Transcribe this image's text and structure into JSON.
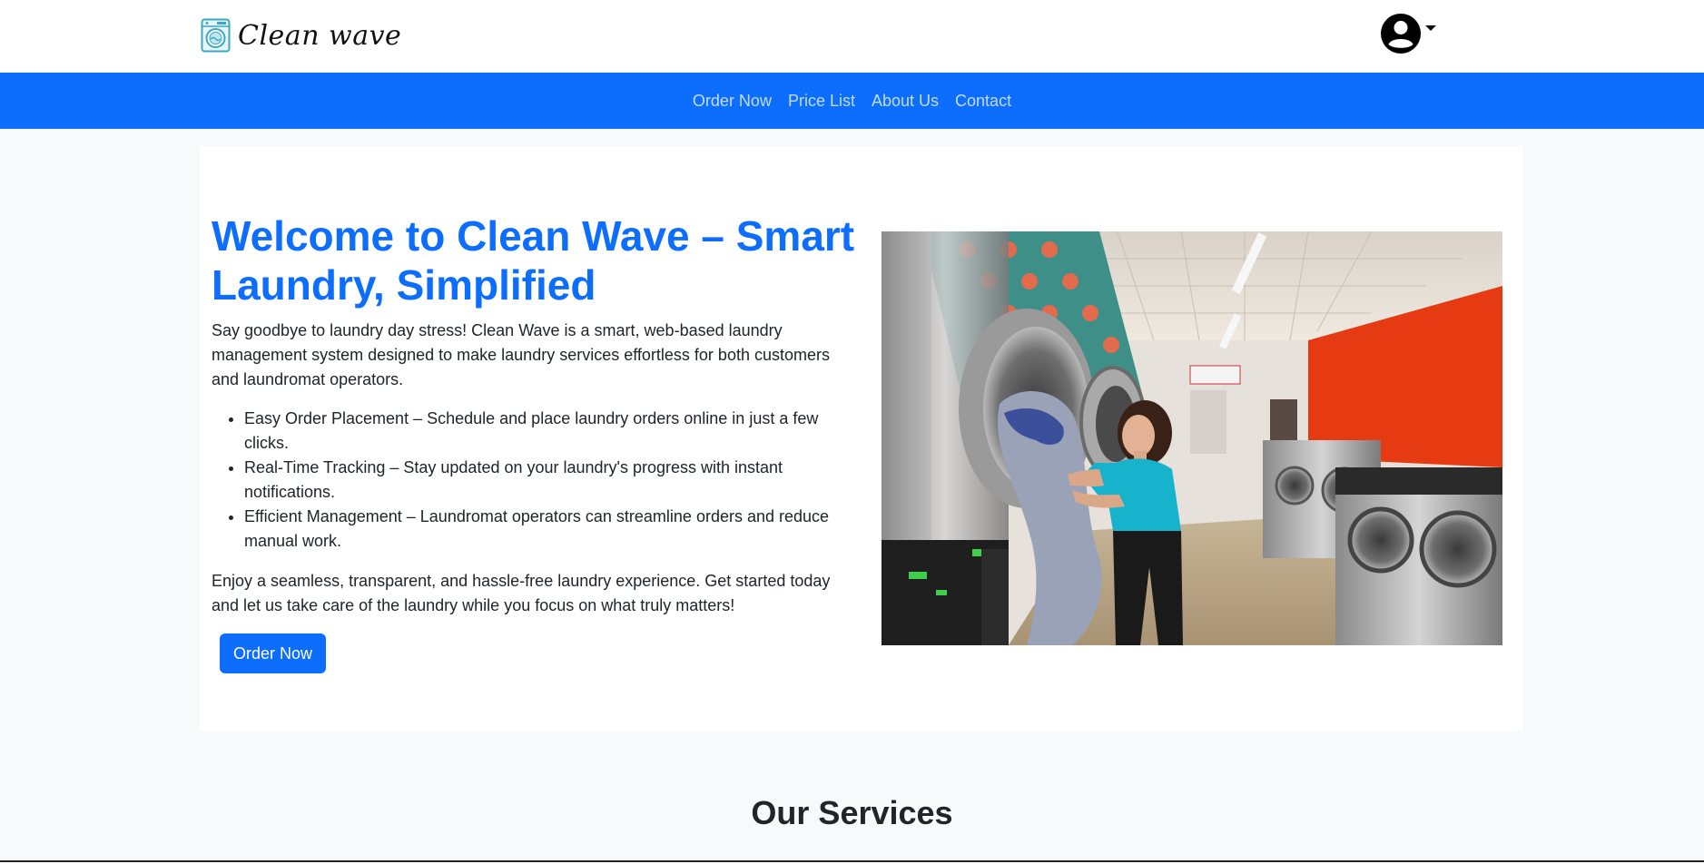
{
  "brand": {
    "name": "Clean wave",
    "logo_icon": "washing-machine-logo-icon"
  },
  "user_menu": {
    "icon": "user-circle-icon"
  },
  "nav": {
    "items": [
      {
        "label": "Order Now"
      },
      {
        "label": "Price List"
      },
      {
        "label": "About Us"
      },
      {
        "label": "Contact"
      }
    ]
  },
  "hero": {
    "title": "Welcome to Clean Wave – Smart Laundry, Simplified",
    "intro": "Say goodbye to laundry day stress! Clean Wave is a smart, web-based laundry management system designed to make laundry services effortless for both customers and laundromat operators.",
    "features": [
      "Easy Order Placement – Schedule and place laundry orders online in just a few clicks.",
      "Real-Time Tracking – Stay updated on your laundry's progress with instant notifications.",
      "Efficient Management – Laundromat operators can streamline orders and reduce manual work."
    ],
    "outro": "Enjoy a seamless, transparent, and hassle-free laundry experience. Get started today and let us take care of the laundry while you focus on what truly matters!",
    "cta_label": "Order Now"
  },
  "services": {
    "title": "Our Services"
  },
  "colors": {
    "primary": "#0d6efd",
    "page_bg": "#f8f9fa",
    "accent_red": "#e63a12",
    "accent_teal": "#1aaec5"
  }
}
